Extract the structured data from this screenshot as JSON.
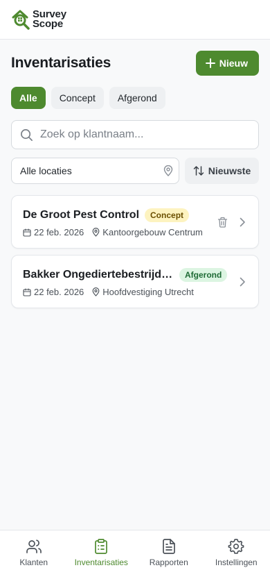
{
  "app": {
    "logo_line1": "Survey",
    "logo_line2": "Scope",
    "brand_color": "#4e8a2f"
  },
  "page": {
    "title": "Inventarisaties",
    "new_button_label": "Nieuw"
  },
  "tabs": [
    {
      "label": "Alle",
      "active": true
    },
    {
      "label": "Concept",
      "active": false
    },
    {
      "label": "Afgerond",
      "active": false
    }
  ],
  "search": {
    "placeholder": "Zoek op klantnaam...",
    "value": ""
  },
  "filters": {
    "location_value": "Alle locaties",
    "sort_label": "Nieuwste"
  },
  "cards": [
    {
      "title": "De Groot Pest Control",
      "status": "Concept",
      "date": "22 feb. 2026",
      "location": "Kantoorgebouw Centrum",
      "has_delete": true
    },
    {
      "title": "Bakker Ongediertebestrijding",
      "status": "Afgerond",
      "date": "22 feb. 2026",
      "location": "Hoofdvestiging Utrecht",
      "has_delete": false
    }
  ],
  "bottom_nav": [
    {
      "label": "Klanten",
      "icon": "users-icon",
      "active": false
    },
    {
      "label": "Inventarisaties",
      "icon": "clipboard-list-icon",
      "active": true
    },
    {
      "label": "Rapporten",
      "icon": "file-text-icon",
      "active": false
    },
    {
      "label": "Instellingen",
      "icon": "settings-icon",
      "active": false
    }
  ]
}
